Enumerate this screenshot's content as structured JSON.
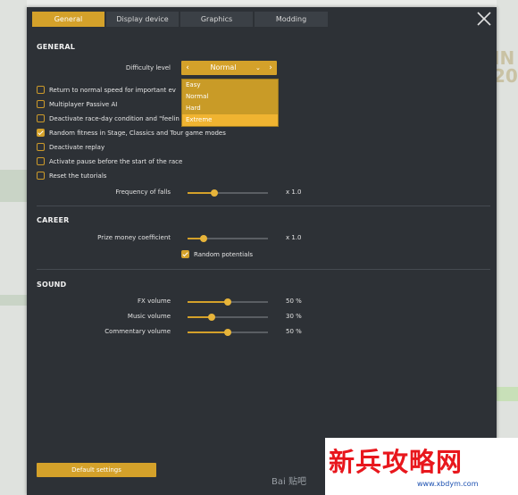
{
  "tabs": [
    {
      "label": "General",
      "active": true
    },
    {
      "label": "Display device",
      "active": false
    },
    {
      "label": "Graphics",
      "active": false
    },
    {
      "label": "Modding",
      "active": false
    }
  ],
  "general": {
    "title": "GENERAL",
    "difficulty": {
      "label": "Difficulty level",
      "value": "Normal",
      "options": [
        "Easy",
        "Normal",
        "Hard",
        "Extreme"
      ],
      "highlighted": "Extreme"
    },
    "checkboxes": [
      {
        "label": "Return to normal speed for important ev",
        "checked": false
      },
      {
        "label": "Multiplayer Passive AI",
        "checked": false
      },
      {
        "label": "Deactivate race-day condition and \"feelin",
        "checked": false
      },
      {
        "label": "Random fitness in Stage, Classics and Tour game modes",
        "checked": true
      },
      {
        "label": "Deactivate replay",
        "checked": false
      },
      {
        "label": "Activate pause before the start of the race",
        "checked": false
      },
      {
        "label": "Reset the tutorials",
        "checked": false
      }
    ],
    "falls": {
      "label": "Frequency of falls",
      "value_text": "x 1.0",
      "level": 0.33
    }
  },
  "career": {
    "title": "CAREER",
    "prize": {
      "label": "Prize money coefficient",
      "value_text": "x 1.0",
      "level": 0.2
    },
    "random_potentials": {
      "label": "Random potentials",
      "checked": true
    }
  },
  "sound": {
    "title": "SOUND",
    "sliders": [
      {
        "label": "FX volume",
        "value_text": "50 %",
        "level": 0.5
      },
      {
        "label": "Music volume",
        "value_text": "30 %",
        "level": 0.3
      },
      {
        "label": "Commentary volume",
        "value_text": "50 %",
        "level": 0.5
      }
    ]
  },
  "footer": {
    "default_label": "Default settings"
  },
  "watermarks": {
    "baidu": "Bai 贴吧",
    "site_name": "新兵攻略网",
    "site_url": "www.xbdym.com"
  },
  "colors": {
    "accent": "#d4a12a",
    "panel": "#2d3136"
  }
}
